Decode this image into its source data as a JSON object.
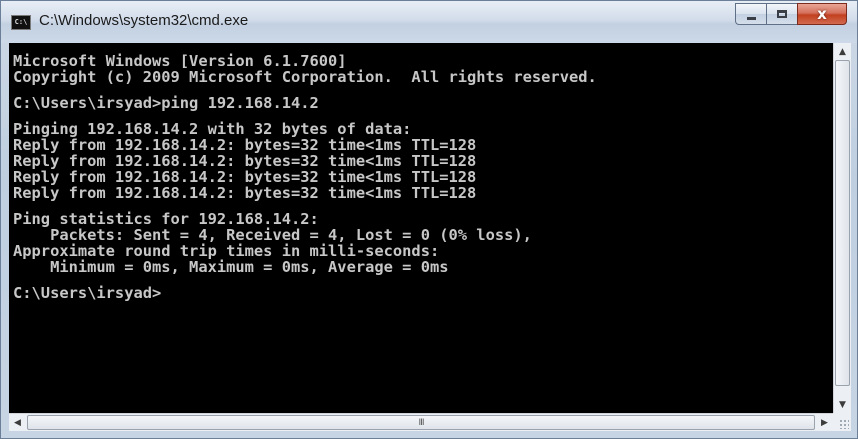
{
  "window": {
    "title": "C:\\Windows\\system32\\cmd.exe",
    "icon": "cmd-icon",
    "icon_text": "C:\\",
    "controls": {
      "minimize": "minimize-icon",
      "maximize": "maximize-icon",
      "close": "close-icon",
      "close_glyph": "x"
    }
  },
  "console": {
    "lines": [
      "Microsoft Windows [Version 6.1.7600]",
      "Copyright (c) 2009 Microsoft Corporation.  All rights reserved.",
      "",
      "C:\\Users\\irsyad>ping 192.168.14.2",
      "",
      "Pinging 192.168.14.2 with 32 bytes of data:",
      "Reply from 192.168.14.2: bytes=32 time<1ms TTL=128",
      "Reply from 192.168.14.2: bytes=32 time<1ms TTL=128",
      "Reply from 192.168.14.2: bytes=32 time<1ms TTL=128",
      "Reply from 192.168.14.2: bytes=32 time<1ms TTL=128",
      "",
      "Ping statistics for 192.168.14.2:",
      "    Packets: Sent = 4, Received = 4, Lost = 0 (0% loss),",
      "Approximate round trip times in milli-seconds:",
      "    Minimum = 0ms, Maximum = 0ms, Average = 0ms",
      "",
      "C:\\Users\\irsyad>"
    ],
    "text_color": "#c7c7c7",
    "background": "#000000"
  },
  "scrollbars": {
    "up_glyph": "▲",
    "down_glyph": "▼",
    "left_glyph": "◀",
    "right_glyph": "▶",
    "grip_glyph": "III"
  }
}
